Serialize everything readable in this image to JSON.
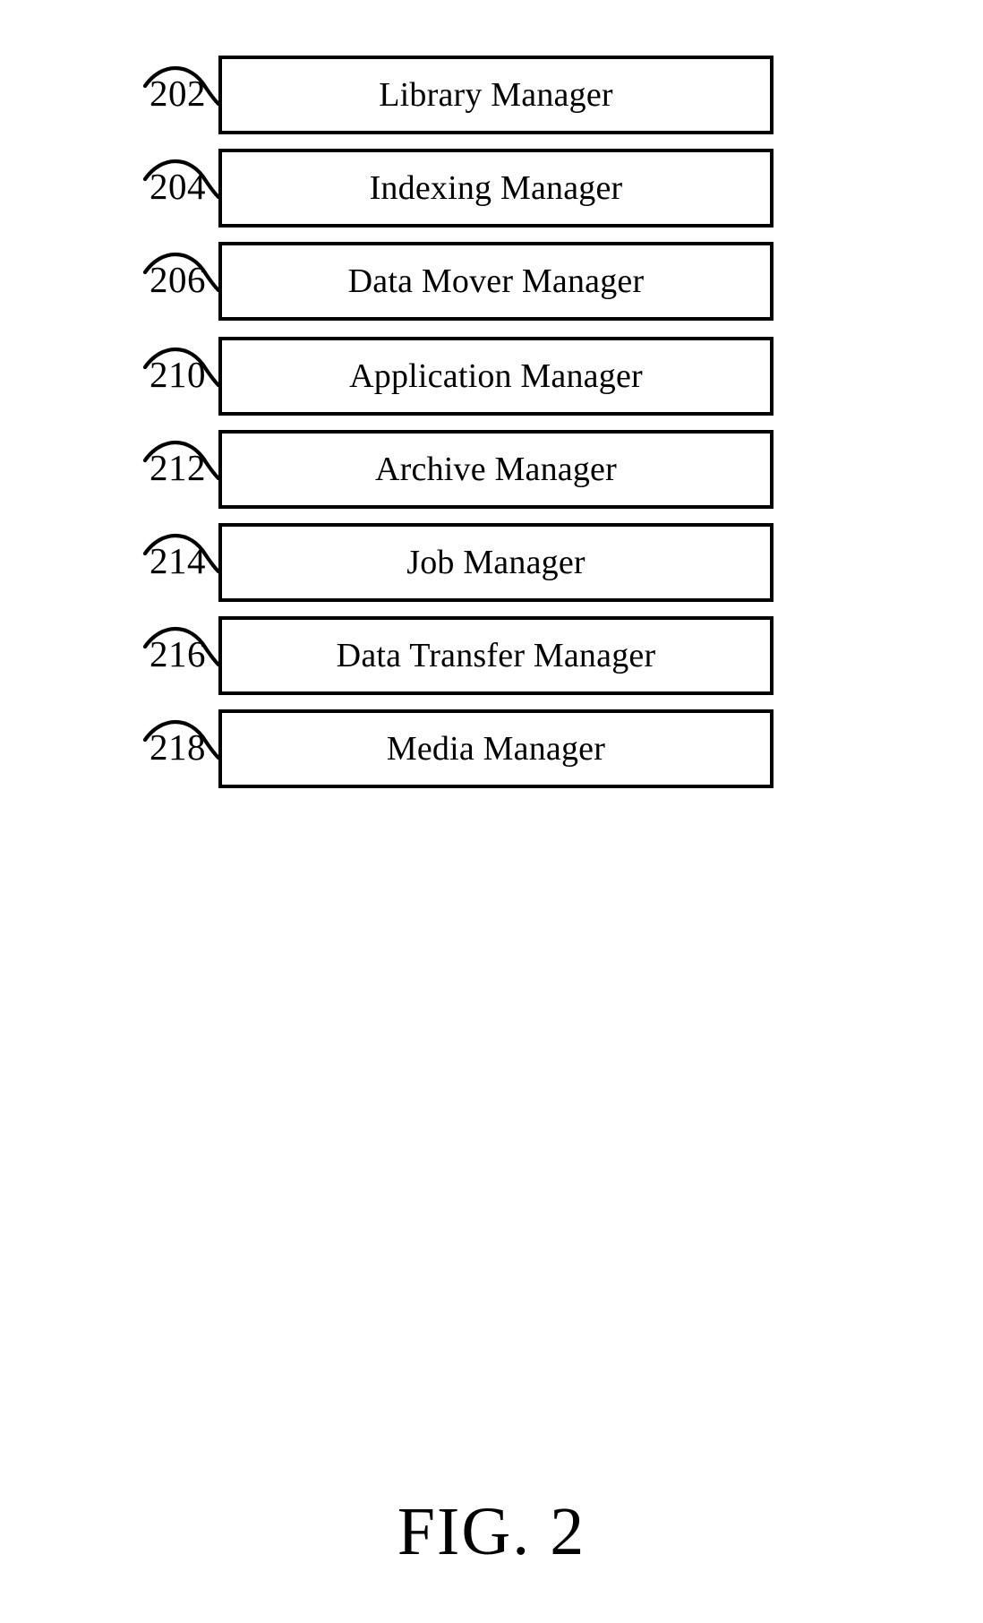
{
  "figure": {
    "caption": "FIG. 2",
    "blocks": [
      {
        "ref": "202",
        "label": "Library Manager"
      },
      {
        "ref": "204",
        "label": "Indexing Manager"
      },
      {
        "ref": "206",
        "label": "Data Mover Manager"
      },
      {
        "ref": "210",
        "label": "Application Manager"
      },
      {
        "ref": "212",
        "label": "Archive Manager"
      },
      {
        "ref": "214",
        "label": "Job Manager"
      },
      {
        "ref": "216",
        "label": "Data Transfer Manager"
      },
      {
        "ref": "218",
        "label": "Media Manager"
      }
    ]
  },
  "colors": {
    "ink": "#000000",
    "paper": "#ffffff"
  }
}
